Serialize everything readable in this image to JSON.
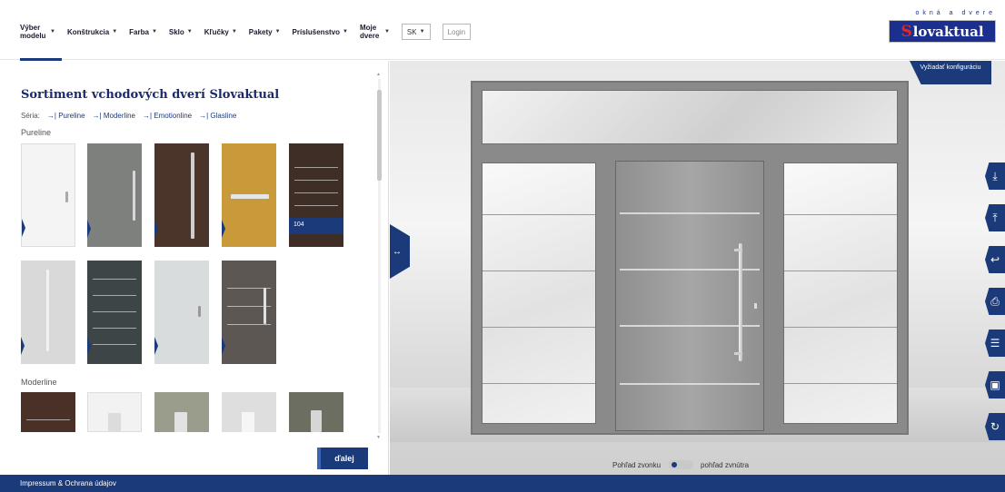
{
  "header": {
    "nav": [
      {
        "label": "Výber modelu",
        "two_line": true
      },
      {
        "label": "Konštrukcia"
      },
      {
        "label": "Farba"
      },
      {
        "label": "Sklo"
      },
      {
        "label": "Kľučky"
      },
      {
        "label": "Pakety"
      },
      {
        "label": "Príslušenstvo"
      },
      {
        "label": "Moje dvere",
        "two_line": true
      }
    ],
    "language": "SK",
    "login": "Login",
    "logo_tagline": "okná a dvere",
    "logo_text": "lovaktual",
    "logo_mark": "S"
  },
  "left_panel": {
    "title": "Sortiment vchodových dverí Slovaktual",
    "series_label": "Séria:",
    "series_links": [
      "→| Pureline",
      "→| Moderline",
      "→| Emotionline",
      "→| Glasline"
    ],
    "groups": [
      "Pureline",
      "Moderline"
    ],
    "selected_badge": "104",
    "next_button": "ďalej"
  },
  "viewer": {
    "config_button": "Vyžiadať konfiguráciu",
    "toggle_icon": "↔",
    "view_outside": "Pohľad zvonku",
    "view_inside": "pohľad zvnútra",
    "tools": [
      {
        "icon": "download-icon",
        "glyph": "⤓"
      },
      {
        "icon": "upload-icon",
        "glyph": "⤒"
      },
      {
        "icon": "undo-icon",
        "glyph": "↩"
      },
      {
        "icon": "print-icon",
        "glyph": "⎙"
      },
      {
        "icon": "list-icon",
        "glyph": "☰"
      },
      {
        "icon": "image-icon",
        "glyph": "▣"
      },
      {
        "icon": "reset-icon",
        "glyph": "↻"
      }
    ]
  },
  "footer": {
    "link": "Impressum & Ochrana údajov"
  },
  "colors": {
    "brand": "#1b3a7a",
    "logo_blue": "#1b2f8f",
    "logo_red": "#e12727"
  }
}
